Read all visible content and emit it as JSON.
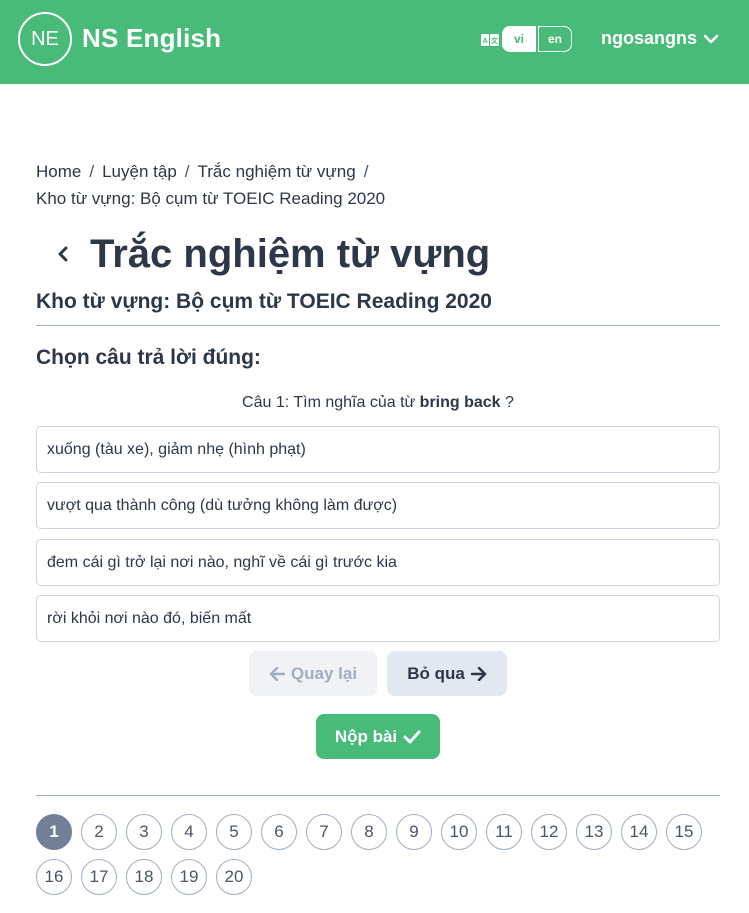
{
  "header": {
    "logo_text": "NE",
    "brand": "NS English",
    "languages": [
      "vi",
      "en"
    ],
    "active_language": "vi",
    "username": "ngosangns",
    "color": "#48bb78"
  },
  "breadcrumb": {
    "items": [
      "Home",
      "Luyện tập",
      "Trắc nghiệm từ vựng",
      "Kho từ vựng: Bộ cụm từ TOEIC Reading 2020"
    ],
    "separator": "/"
  },
  "page": {
    "title": "Trắc nghiệm từ vựng",
    "subtitle": "Kho từ vựng: Bộ cụm từ TOEIC Reading 2020",
    "prompt": "Chọn câu trả lời đúng:"
  },
  "question": {
    "prefix": "Câu 1: Tìm nghĩa của từ",
    "term": "bring back",
    "suffix": "?"
  },
  "options": [
    "xuống (tàu xe), giảm nhẹ (hình phạt)",
    "vượt qua thành công (dù tưởng không làm được)",
    "đem cái gì trở lại nơi nào, nghĩ về cái gì trước kia",
    "rời khỏi nơi nào đó, biến mất"
  ],
  "buttons": {
    "back": "Quay lại",
    "skip": "Bỏ qua",
    "submit": "Nộp bài"
  },
  "pagination": {
    "pages": [
      "1",
      "2",
      "3",
      "4",
      "5",
      "6",
      "7",
      "8",
      "9",
      "10",
      "11",
      "12",
      "13",
      "14",
      "15",
      "16",
      "17",
      "18",
      "19",
      "20"
    ],
    "current": "1"
  }
}
